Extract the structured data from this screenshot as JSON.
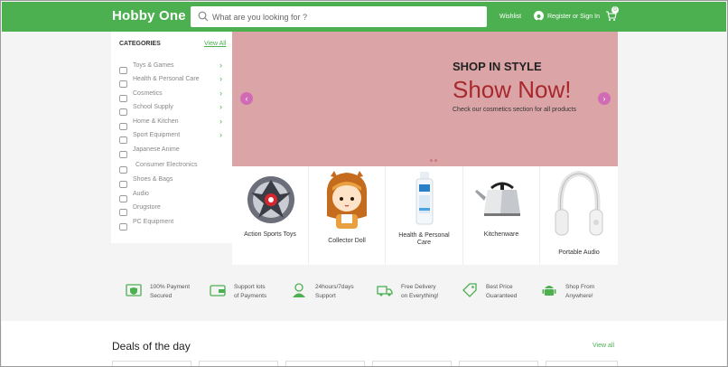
{
  "header": {
    "logo": "Hobby One",
    "search_placeholder": "What are you looking for ?",
    "wishlist": "Wishlist",
    "register": "Register or Sign In",
    "cart_count": "0",
    "accent": "#4caf50"
  },
  "sidebar": {
    "title": "CATEGORIES",
    "view_all": "View All",
    "items": [
      {
        "label": "Toys & Games",
        "icon": "toy-icon",
        "arrow": true
      },
      {
        "label": "Health & Personal Care",
        "icon": "health-icon",
        "arrow": true
      },
      {
        "label": "Cosmetics",
        "icon": "cosmetics-icon",
        "arrow": true
      },
      {
        "label": "School Supply",
        "icon": "school-icon",
        "arrow": true
      },
      {
        "label": "Home & Kitchen",
        "icon": "home-icon",
        "arrow": true
      },
      {
        "label": "Sport Equipment",
        "icon": "sport-icon",
        "arrow": true
      },
      {
        "label": "Japanese Anime",
        "icon": "anime-icon",
        "arrow": false
      },
      {
        "label": "Consumer Electronics",
        "icon": "monitor-icon",
        "arrow": false
      },
      {
        "label": "Shoes & Bags",
        "icon": "bag-icon",
        "arrow": false
      },
      {
        "label": "Audio",
        "icon": "audio-icon",
        "arrow": false
      },
      {
        "label": "Drugstore",
        "icon": "drug-icon",
        "arrow": false
      },
      {
        "label": "PC Equipment",
        "icon": "pc-icon",
        "arrow": false
      }
    ]
  },
  "banner": {
    "kicker": "SHOP IN STYLE",
    "headline": "Show Now!",
    "subtitle": "Check our cosmetics section for all products",
    "bg_color": "#dba5a8",
    "headline_color": "#a8282c"
  },
  "products": [
    {
      "name": "Action Sports Toys",
      "icon": "spinning-top-icon"
    },
    {
      "name": "Collector Doll",
      "icon": "doll-icon"
    },
    {
      "name": "Health & Personal Care",
      "icon": "bottle-icon"
    },
    {
      "name": "Kitchenware",
      "icon": "kettle-icon"
    },
    {
      "name": "Portable Audio",
      "icon": "headphones-icon"
    }
  ],
  "features": [
    {
      "line1": "100% Payment",
      "line2": "Secured",
      "icon": "shield-check-icon"
    },
    {
      "line1": "Support lots",
      "line2": "of Payments",
      "icon": "wallet-icon"
    },
    {
      "line1": "24hours/7days",
      "line2": "Support",
      "icon": "support-agent-icon"
    },
    {
      "line1": "Free Delivery",
      "line2": "on Everything!",
      "icon": "truck-icon"
    },
    {
      "line1": "Best Price",
      "line2": "Guaranteed",
      "icon": "price-tag-icon"
    },
    {
      "line1": "Shop From",
      "line2": "Anywhere!",
      "icon": "android-icon"
    }
  ],
  "deals": {
    "title": "Deals of the day",
    "view_all": "View all"
  }
}
